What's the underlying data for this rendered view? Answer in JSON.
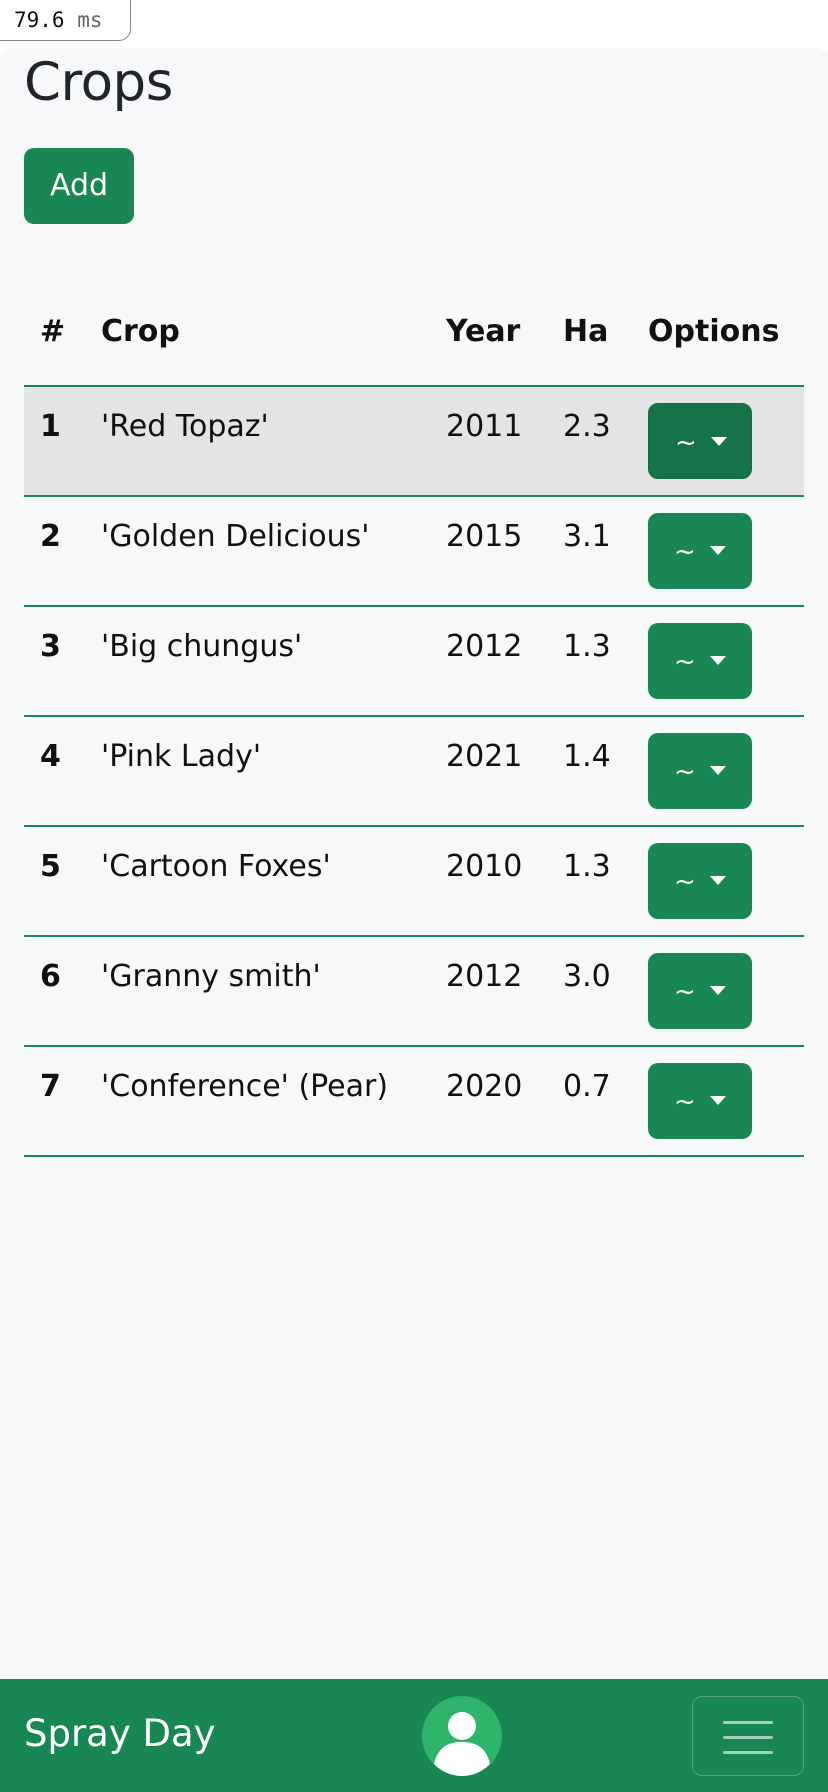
{
  "perf": {
    "value": "79.6",
    "unit": "ms"
  },
  "page": {
    "title": "Crops"
  },
  "actions": {
    "add_label": "Add"
  },
  "table": {
    "headers": {
      "num": "#",
      "crop": "Crop",
      "year": "Year",
      "ha": "Ha",
      "options": "Options"
    },
    "rows": [
      {
        "num": "1",
        "crop": "'Red Topaz'",
        "year": "2011",
        "ha": "2.3",
        "option": "~"
      },
      {
        "num": "2",
        "crop": "'Golden Delicious'",
        "year": "2015",
        "ha": "3.1",
        "option": "~"
      },
      {
        "num": "3",
        "crop": "'Big chungus'",
        "year": "2012",
        "ha": "1.3",
        "option": "~"
      },
      {
        "num": "4",
        "crop": "'Pink Lady'",
        "year": "2021",
        "ha": "1.4",
        "option": "~"
      },
      {
        "num": "5",
        "crop": "'Cartoon Foxes'",
        "year": "2010",
        "ha": "1.3",
        "option": "~"
      },
      {
        "num": "6",
        "crop": "'Granny smith'",
        "year": "2012",
        "ha": "3.0",
        "option": "~"
      },
      {
        "num": "7",
        "crop": "'Conference' (Pear)",
        "year": "2020",
        "ha": "0.7",
        "option": "~"
      }
    ],
    "active_row": 0
  },
  "navbar": {
    "brand": "Spray Day",
    "avatar_icon": "user-avatar-icon",
    "menu_icon": "hamburger-menu-icon"
  },
  "colors": {
    "primary": "#198754",
    "primary_active": "#157347",
    "background": "#f7f8fa",
    "row_hover": "#e3e4e6"
  }
}
